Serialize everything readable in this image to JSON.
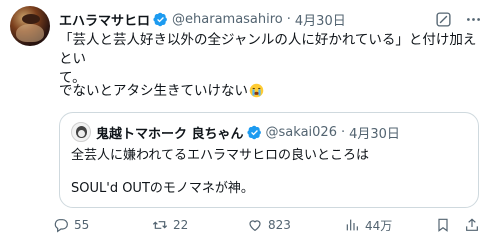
{
  "author": {
    "name": "エハラマサヒロ",
    "handle": "@eharamasahiro",
    "separator": "·",
    "date": "4月30日"
  },
  "post": {
    "line1": "「芸人と芸人好き以外の全ジャンルの人に好かれている」と付け加えとい",
    "line1b": "て。",
    "line2": "でないとアタシ生きていけない"
  },
  "quote": {
    "name": "鬼越トマホーク 良ちゃん",
    "handle": "@sakai026",
    "separator": "·",
    "date": "4月30日",
    "line1": "全芸人に嫌われてるエハラマサヒロの良いところは",
    "line2": "SOUL'd OUTのモノマネが神。"
  },
  "actions": {
    "reply_count": "55",
    "repost_count": "22",
    "like_count": "823",
    "views_count": "44万"
  },
  "icons": {
    "verified": "verified-badge-icon",
    "grok": "grok-icon",
    "more": "more-icon",
    "emoji": "loudly-crying-face-emoji",
    "reply": "reply-icon",
    "repost": "repost-icon",
    "like": "heart-icon",
    "views": "views-icon",
    "bookmark": "bookmark-icon",
    "share": "share-icon"
  },
  "colors": {
    "verified": "#1d9bf0",
    "text": "#0f1419",
    "secondary": "#536471",
    "border": "#cfd9de"
  }
}
